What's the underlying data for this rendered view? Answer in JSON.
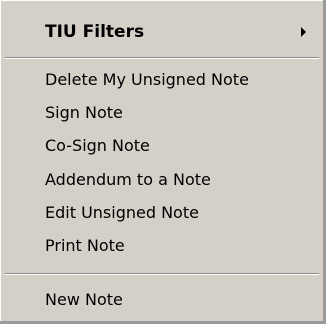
{
  "menu": {
    "submenu_label": "TIU Filters",
    "items": [
      "Delete My Unsigned Note",
      "Sign Note",
      "Co-Sign Note",
      "Addendum to a Note",
      "Edit Unsigned Note",
      "Print Note"
    ],
    "new_note_label": "New Note"
  }
}
